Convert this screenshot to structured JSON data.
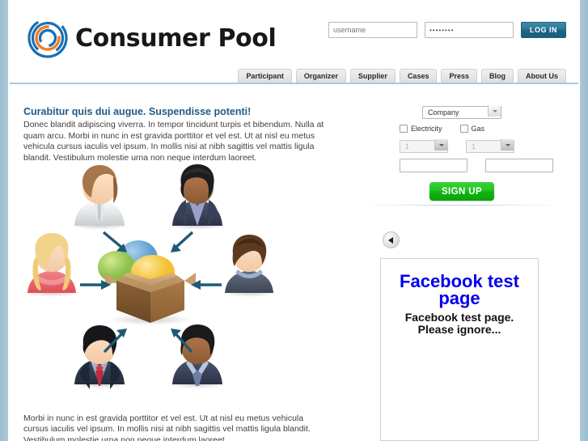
{
  "brand": {
    "name": "Consumer Pool",
    "logo_icon": "spiral-circles-logo",
    "logo_blue": "#1a6fb5",
    "logo_orange": "#f07d22"
  },
  "login": {
    "username_placeholder": "username",
    "username_value": "",
    "password_value": "••••••••",
    "password_placeholder": "",
    "button_label": "LOG IN"
  },
  "nav": {
    "items": [
      {
        "label": "Participant"
      },
      {
        "label": "Organizer"
      },
      {
        "label": "Supplier"
      },
      {
        "label": "Cases"
      },
      {
        "label": "Press"
      },
      {
        "label": "Blog"
      },
      {
        "label": "About Us"
      }
    ]
  },
  "main": {
    "heading": "Curabitur quis dui augue. Suspendisse potenti!",
    "paragraph": "Donec blandit adipiscing viverra. In tempor tincidunt turpis et bibendum. Nulla at quam arcu. Morbi in nunc in est gravida porttitor et vel est. Ut at nisl eu metus vehicula cursus iaculis vel ipsum. In mollis nisi at nibh sagittis vel mattis ligula blandit. Vestibulum molestie urna non neque interdum laoreet.",
    "bottom_paragraph": "Morbi in nunc in est gravida porttitor et vel est. Ut at nisl eu metus vehicula cursus iaculis vel ipsum. In mollis nisi at nibh sagittis vel mattis ligula blandit. Vestibulum molestie urna non neque interdum laoreet.",
    "illustration": {
      "icon": "people-around-box-illustration",
      "center_item": "cardboard-box-with-colored-balls",
      "arrow_color": "#1d5a76",
      "person_count": 6
    }
  },
  "signup": {
    "company_select_value": "Company",
    "company_options": [
      "Company"
    ],
    "electricity_label": "Electricity",
    "electricity_checked": false,
    "gas_label": "Gas",
    "gas_checked": false,
    "electricity_qty_value": "1",
    "gas_qty_value": "1",
    "qty_options": [
      "1"
    ],
    "electricity_text_value": "",
    "gas_text_value": "",
    "button_label": "SIGN UP",
    "button_color": "#1fc21f"
  },
  "sidebar": {
    "back_button_icon": "left-triangle-icon",
    "facebook_widget": {
      "title": "Facebook test page",
      "title_color": "#0000ee",
      "subtitle": "Facebook test page. Please ignore..."
    }
  }
}
